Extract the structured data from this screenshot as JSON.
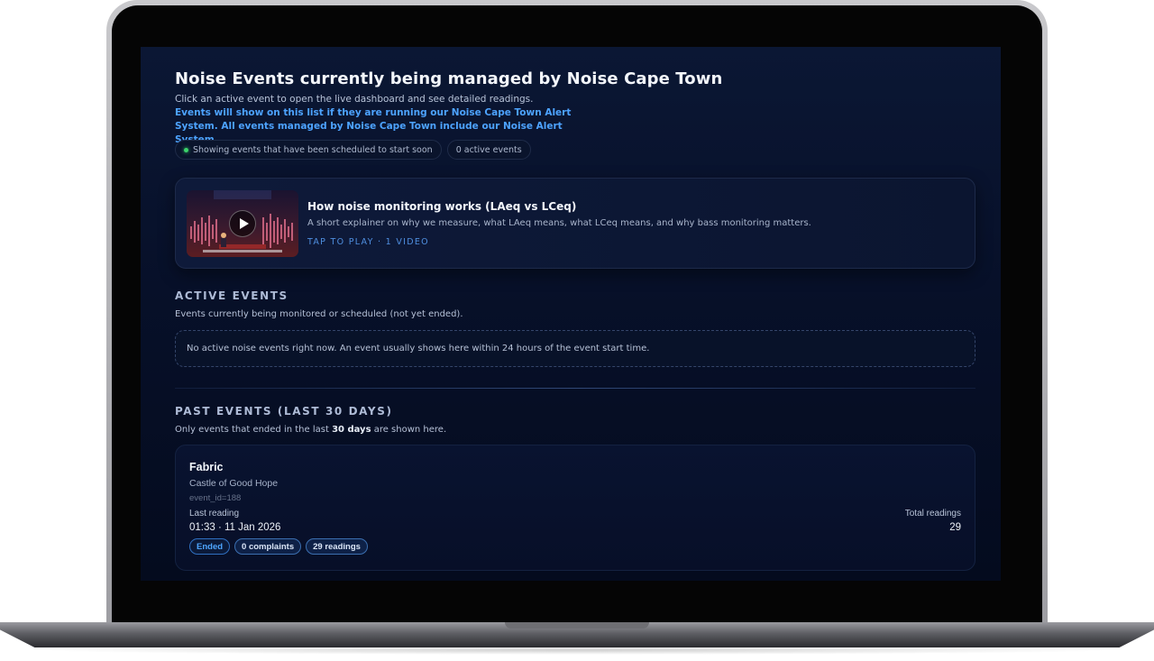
{
  "page": {
    "title": "Noise Events currently being managed by Noise Cape Town",
    "intro_plain": "Click an active event to open the live dashboard and see detailed readings. ",
    "intro_highlight": "Events will show on this list if they are running our Noise Cape Town Alert System. All events managed by Noise Cape Town include our Noise Alert System.",
    "chips": {
      "scheduled": "Showing events that have been scheduled to start soon",
      "active_count": "0 active events"
    }
  },
  "video": {
    "title": "How noise monitoring works (LAeq vs LCeq)",
    "description": "A short explainer on why we measure, what LAeq means, what LCeq means, and why bass monitoring matters.",
    "meta": "TAP TO PLAY · 1 VIDEO"
  },
  "active_events": {
    "heading": "ACTIVE EVENTS",
    "subtitle": "Events currently being monitored or scheduled (not yet ended).",
    "empty_message": "No active noise events right now. An event usually shows here within 24 hours of the event start time."
  },
  "past_events": {
    "heading": "PAST EVENTS (LAST 30 DAYS)",
    "subtitle_pre": "Only events that ended in the last ",
    "subtitle_bold": "30 days",
    "subtitle_post": " are shown here.",
    "items": [
      {
        "name": "Fabric",
        "venue": "Castle of Good Hope",
        "event_id": "event_id=188",
        "last_reading_label": "Last reading",
        "last_reading_value": "01:33 · 11 Jan 2026",
        "total_label": "Total readings",
        "total_value": "29",
        "badges": [
          "Ended",
          "0 complaints",
          "29 readings"
        ]
      }
    ]
  },
  "colors": {
    "background": "#071029",
    "accent": "#4da3ff",
    "status_dot": "#3bd36a"
  }
}
